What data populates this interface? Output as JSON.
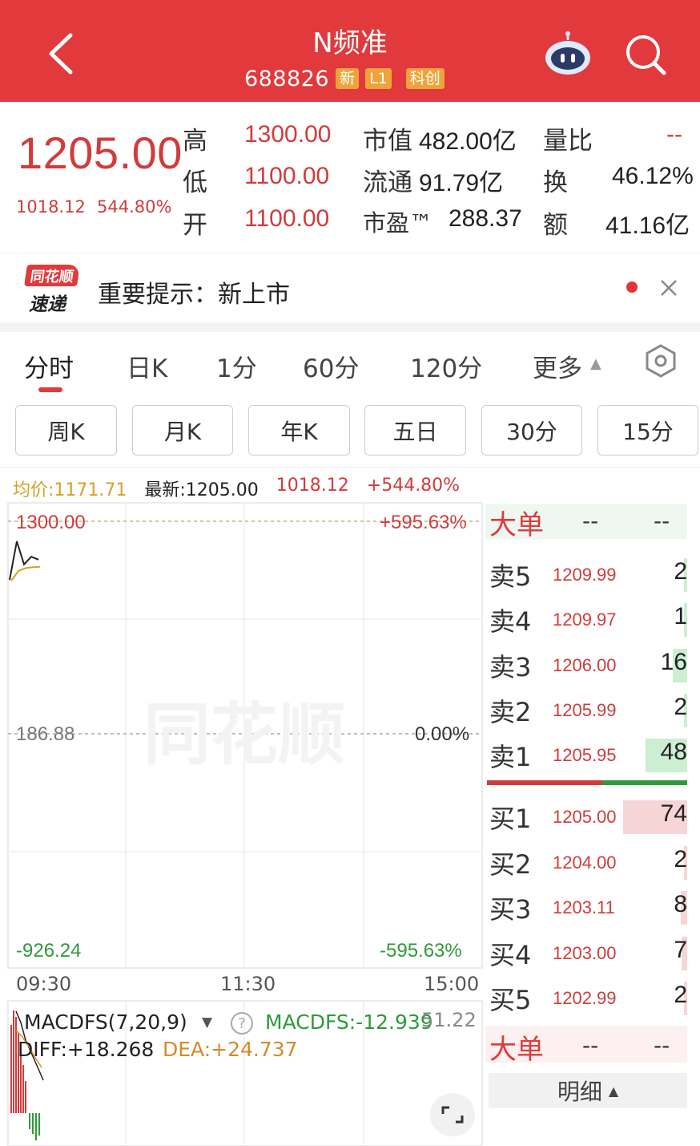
{
  "header": {
    "stock_name": "N频准",
    "stock_code": "688826",
    "tags": [
      "新",
      "L1",
      "科创"
    ],
    "icons": [
      "back-arrow-icon",
      "robot-assistant-icon",
      "search-icon"
    ]
  },
  "quote": {
    "price": "1205.00",
    "change_abs": "1018.12",
    "change_pct": "544.80%",
    "high_label": "高",
    "high": "1300.00",
    "low_label": "低",
    "low": "1100.00",
    "open_label": "开",
    "open": "1100.00",
    "mktcap_label": "市值",
    "mktcap": "482.00亿",
    "float_label": "流通",
    "float_cap": "91.79亿",
    "pe_label": "市盈™",
    "pe": "288.37",
    "vol_ratio_label": "量比",
    "vol_ratio": "--",
    "turnover_label": "换",
    "turnover": "46.12%",
    "amount_label": "额",
    "amount": "41.16亿"
  },
  "notice": {
    "logo_line1": "同花顺",
    "logo_line2": "速递",
    "text": "重要提示：新上市"
  },
  "tabs": [
    "分时",
    "日K",
    "1分",
    "60分",
    "120分",
    "更多"
  ],
  "subtabs": [
    "周K",
    "月K",
    "年K",
    "五日",
    "30分",
    "15分"
  ],
  "info": {
    "avg": "均价:1171.71",
    "last": "最新:1205.00",
    "abs": "1018.12",
    "pct": "+544.80%"
  },
  "chart_data": {
    "type": "line",
    "y_top": "1300.00",
    "y_mid": "186.88",
    "y_bot": "-926.24",
    "pct_top": "+595.63%",
    "pct_mid": "0.00%",
    "pct_bot": "-595.63%",
    "time_labels": [
      "09:30",
      "11:30",
      "15:00"
    ],
    "watermark": "同花顺",
    "series": [
      {
        "values": [
          1100,
          1300,
          1180,
          1220,
          1205
        ]
      },
      {
        "values": [
          1100,
          1150,
          1165,
          1170,
          1171.71
        ]
      }
    ]
  },
  "macd": {
    "label": "MACDFS(7,20,9)",
    "macdfs": "MACDFS:-12.939",
    "top_val": "51.22",
    "diff": "DIFF:+18.268",
    "dea": "DEA:+24.737"
  },
  "orderbook": {
    "big_label": "大单",
    "big_v1": "--",
    "big_v2": "--",
    "asks": [
      {
        "label": "卖5",
        "price": "1209.99",
        "vol": "2",
        "ratio": 0.04
      },
      {
        "label": "卖4",
        "price": "1209.97",
        "vol": "1",
        "ratio": 0.02
      },
      {
        "label": "卖3",
        "price": "1206.00",
        "vol": "16",
        "ratio": 0.22
      },
      {
        "label": "卖2",
        "price": "1205.99",
        "vol": "2",
        "ratio": 0.04
      },
      {
        "label": "卖1",
        "price": "1205.95",
        "vol": "48",
        "ratio": 0.65
      }
    ],
    "bids": [
      {
        "label": "买1",
        "price": "1205.00",
        "vol": "74",
        "ratio": 1.0
      },
      {
        "label": "买2",
        "price": "1204.00",
        "vol": "2",
        "ratio": 0.04
      },
      {
        "label": "买3",
        "price": "1203.11",
        "vol": "8",
        "ratio": 0.1
      },
      {
        "label": "买4",
        "price": "1203.00",
        "vol": "7",
        "ratio": 0.09
      },
      {
        "label": "买5",
        "price": "1202.99",
        "vol": "2",
        "ratio": 0.04
      }
    ],
    "detail_label": "明细"
  },
  "colors": {
    "header_red": "#e2393c",
    "up_red": "#d23b3b",
    "down_green": "#2e9a3a",
    "avg_gold": "#d4a12b"
  }
}
